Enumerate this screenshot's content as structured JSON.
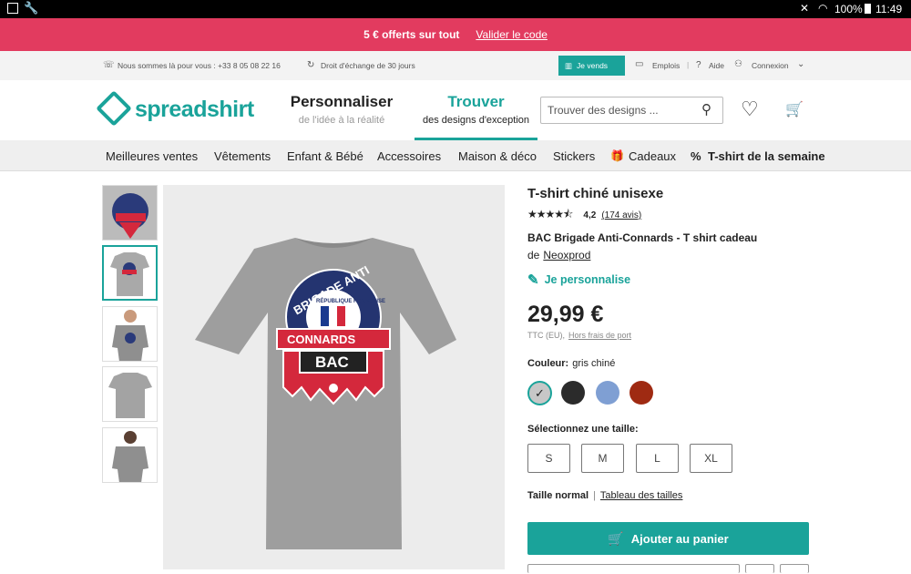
{
  "status_bar": {
    "time": "11:49",
    "battery": "100%"
  },
  "promo": {
    "text": "5 € offerts sur tout",
    "link": "Valider le code"
  },
  "infobar": {
    "phone": "Nous sommes là pour vous : +33 8 05 08 22 16",
    "exchange": "Droit d'échange de 30 jours",
    "sell": "Je vends",
    "jobs": "Emplois",
    "help": "Aide",
    "login": "Connexion"
  },
  "header": {
    "logo": "spreadshirt",
    "tab1_title": "Personnaliser",
    "tab1_sub": "de l'idée à la réalité",
    "tab2_title": "Trouver",
    "tab2_sub": "des designs d'exception",
    "search_placeholder": "Trouver des designs ..."
  },
  "nav": [
    "Meilleures ventes",
    "Vêtements",
    "Enfant & Bébé",
    "Accessoires",
    "Maison & déco",
    "Stickers",
    "Cadeaux",
    "T-shirt de la semaine"
  ],
  "product": {
    "title": "T-shirt chiné unisexe",
    "rating": "4,2",
    "reviews": "(174 avis)",
    "design_title": "BAC Brigade Anti-Connards - T shirt cadeau",
    "by": "de",
    "author": "Neoxprod",
    "personalize": "Je personnalise",
    "price": "29,99 €",
    "ttc": "TTC (EU),",
    "shipping": "Hors frais de port",
    "color_label": "Couleur:",
    "color_value": "gris chiné",
    "size_label": "Sélectionnez une taille:",
    "sizes": [
      "S",
      "M",
      "L",
      "XL"
    ],
    "fit": "Taille normal",
    "size_table": "Tableau des tailles",
    "add_to_cart": "Ajouter au panier",
    "stars": 4.2
  },
  "design": {
    "arc_text": "BRIGADE ANTI",
    "sub_text": "RÉPUBLIQUE FRANÇAISE",
    "banner": "CONNARDS",
    "badge": "BAC"
  },
  "colors": {
    "accent": "#1aa39a",
    "promo": "#e23b5f",
    "swatches": [
      "#c7c7c7",
      "#2b2b2b",
      "#7f9fd3",
      "#9f2a12"
    ]
  }
}
